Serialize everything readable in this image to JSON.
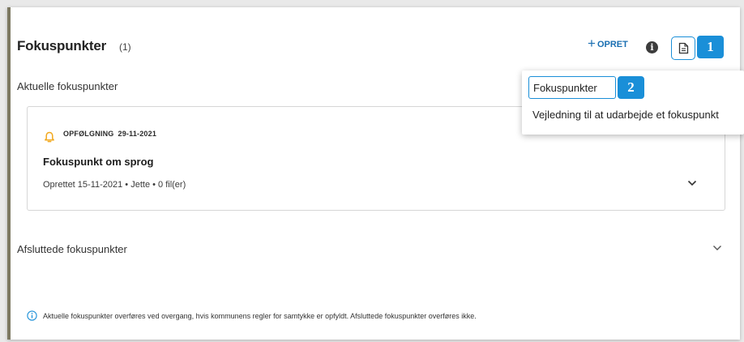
{
  "header": {
    "title": "Fokuspunkter",
    "count": "(1)",
    "create_label": "OPRET",
    "create_icon": "plus-icon",
    "info_icon": "info-icon",
    "doc_icon": "document-icon"
  },
  "callouts": [
    "1",
    "2"
  ],
  "current_section": {
    "label": "Aktuelle fokuspunkter",
    "items": [
      {
        "status": "OPFØLGNING",
        "date": "29-11-2021",
        "title": "Fokuspunkt om sprog",
        "meta": "Oprettet 15-11-2021 • Jette • 0 fil(er)"
      }
    ]
  },
  "closed_section": {
    "label": "Afsluttede fokuspunkter"
  },
  "footnote": "Aktuelle fokuspunkter overføres ved overgang, hvis kommunens regler for samtykke er opfyldt. Afsluttede fokuspunkter overføres ikke.",
  "dropdown": {
    "items": [
      "Fokuspunkter",
      "Vejledning til at udarbejde et fokuspunkt"
    ]
  },
  "colors": {
    "accent": "#1a8fd8",
    "link": "#1a6fb2",
    "bell": "#f2a81d",
    "panel_border": "#7c7861"
  }
}
